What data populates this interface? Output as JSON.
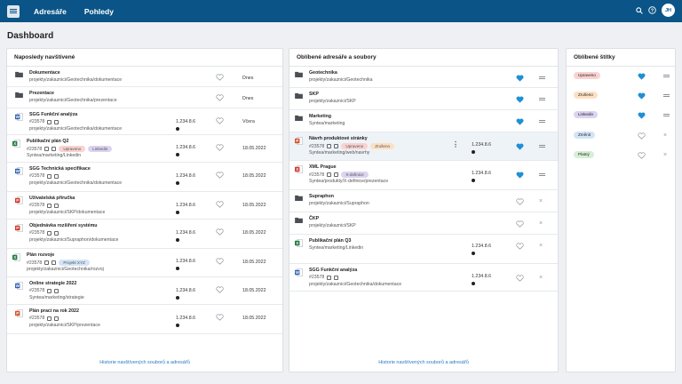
{
  "app": {
    "nav": [
      "Adresáře",
      "Pohledy"
    ],
    "user_initials": "JH",
    "icons": [
      "search-icon",
      "help-icon"
    ]
  },
  "page": {
    "title": "Dashboard"
  },
  "tag_colors": {
    "Upraveno": "#f9d3d0",
    "Zrušeno": "#fde0c4",
    "Linkedin": "#dcd3f0",
    "Projekt XYZ": "#d3e4f7",
    "X-definice": "#dcd3f0",
    "Změnit": "#d3e4f7",
    "Platný": "#d6f0d6"
  },
  "recent": {
    "title": "Naposledy navštívené",
    "footer": "Historie navštívených souborů a adresářů",
    "items": [
      {
        "type": "folder",
        "name": "Dokumentace",
        "path": "projekty/zakaznici/Geotechnika/dokumentace",
        "date": "Dnes"
      },
      {
        "type": "folder",
        "name": "Prezentace",
        "path": "projekty/zakaznici/Geotechnika/prezentace",
        "date": "Dnes"
      },
      {
        "type": "word",
        "name": "SGG Funkční analýza",
        "sub": "#23578",
        "path": "projekty/zakaznici/Geotechnika/dokumentace",
        "version": "1.234.8.6",
        "date": "Včera"
      },
      {
        "type": "excel",
        "name": "Publikační plán Q2",
        "sub": "#23578",
        "tags": [
          "Upraveno",
          "Linkedin"
        ],
        "path": "Syntea/marketing/Linkedin",
        "version": "1.234.8.6",
        "date": "18.05.2022"
      },
      {
        "type": "word",
        "name": "SGG Technická specifikace",
        "sub": "#23578",
        "path": "projekty/zakaznici/Geotechnika/dokumentace",
        "version": "1.234.8.6",
        "date": "18.05.2022"
      },
      {
        "type": "pdf",
        "name": "Uživatelská příručka",
        "sub": "#23578",
        "path": "projekty/zakaznici/SKP/dokumentace",
        "version": "1.234.8.6",
        "date": "18.05.2022"
      },
      {
        "type": "pdf",
        "name": "Objednávka rozšíření systému",
        "sub": "#23578",
        "path": "projekty/zakaznici/Supraphon/dokumentace",
        "version": "1.234.8.6",
        "date": "18.05.2022"
      },
      {
        "type": "excel",
        "name": "Plán rozvoje",
        "sub": "#23578",
        "tags": [
          "Projekt XYZ"
        ],
        "path": "projekty/zakaznici/Geotechnika/rozvoj",
        "version": "1.234.8.6",
        "date": "18.05.2022"
      },
      {
        "type": "word",
        "name": "Online strategie 2022",
        "sub": "#23578",
        "path": "Syntea/marketing/strategie",
        "version": "1.234.8.6",
        "date": "18.05.2022"
      },
      {
        "type": "ppt",
        "name": "Plán prací na rok 2022",
        "sub": "#23578",
        "path": "projekty/zakaznici/SKP/prezentace",
        "version": "1.234.8.6",
        "date": "18.05.2022"
      }
    ]
  },
  "favorites": {
    "title": "Oblíbené adresáře a soubory",
    "footer": "Historie navštívených souborů a adresářů",
    "items": [
      {
        "type": "folder",
        "name": "Geotechnika",
        "path": "projekty/zakaznici/Geotechnika",
        "fav": true
      },
      {
        "type": "folder",
        "name": "SKP",
        "path": "projekty/zakaznici/SKP",
        "fav": true
      },
      {
        "type": "folder",
        "name": "Marketing",
        "path": "Syntea/marketing",
        "fav": true
      },
      {
        "type": "ppt",
        "name": "Návrh produktové stránky",
        "sub": "#23578",
        "tags": [
          "Upraveno",
          "Zrušeno"
        ],
        "path": "Syntea/marketing/web/navrhy",
        "version": "1.234.8.6",
        "fav": true,
        "active": true
      },
      {
        "type": "xml",
        "name": "XML Prague",
        "sub": "#23578",
        "tags": [
          "X-definice"
        ],
        "path": "Syntea/produkty/X-definice/prezentace",
        "version": "1.234.8.6",
        "fav": true
      },
      {
        "type": "folder",
        "name": "Supraphon",
        "path": "projekty/zakaznici/Supraphon",
        "fav": false
      },
      {
        "type": "folder",
        "name": "ČKP",
        "path": "projekty/zakaznici/SKP",
        "fav": false
      },
      {
        "type": "excel",
        "name": "Publikační plán Q3",
        "path": "Syntea/marketing/Linkedin",
        "version": "1.234.8.6",
        "fav": false
      },
      {
        "type": "word",
        "name": "SGG Funkční analýza",
        "sub": "#23578",
        "path": "projekty/zakaznici/Geotechnika/dokumentace",
        "version": "1.234.8.6",
        "fav": false
      }
    ]
  },
  "labels": {
    "title": "Oblíbené štítky",
    "items": [
      {
        "name": "Upraveno",
        "fav": true
      },
      {
        "name": "Zrušeno",
        "fav": true
      },
      {
        "name": "Linkedin",
        "fav": true
      },
      {
        "name": "Změnit",
        "fav": false
      },
      {
        "name": "Platný",
        "fav": false
      }
    ]
  }
}
